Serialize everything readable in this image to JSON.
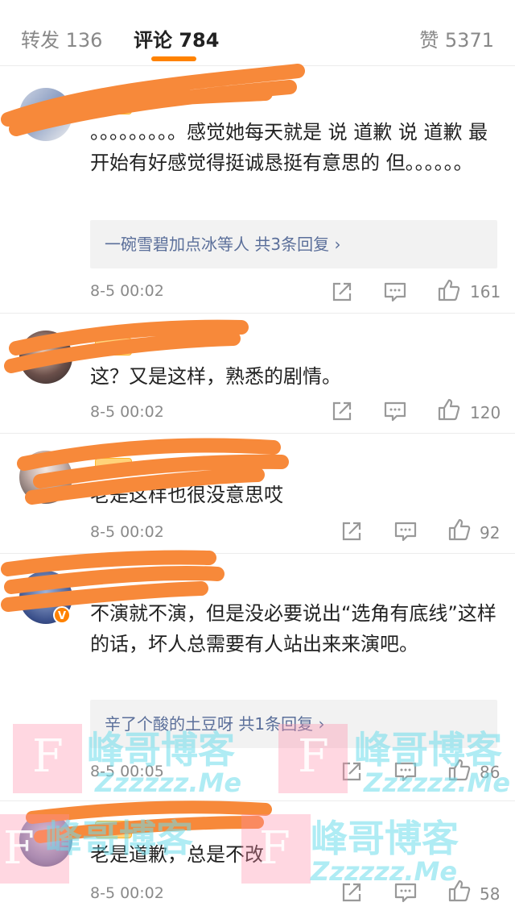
{
  "tabs": {
    "repost": "转发 136",
    "comments": "评论 784",
    "likes": "赞 5371"
  },
  "comments": [
    {
      "text": "。。。。。。。。。感觉她每天就是 说 道歉 说 道歉 最开始有好感觉得挺诚恳挺有意思的 但。。。。。。",
      "reply_summary": "一碗雪碧加点冰等人  共3条回复 ›",
      "time": "8-5 00:02",
      "likes": "161"
    },
    {
      "text": "这？又是这样，熟悉的剧情。",
      "time": "8-5 00:02",
      "likes": "120"
    },
    {
      "text": "老是这样也很没意思哎",
      "time": "8-5 00:02",
      "likes": "92"
    },
    {
      "text": "不演就不演，但是没必要说出“选角有底线”这样的话，坏人总需要有人站出来来演吧。",
      "reply_summary": "辛了个酸的土豆呀  共1条回复 ›",
      "time": "8-5 00:05",
      "likes": "86"
    },
    {
      "text": "老是道歉，总是不改",
      "time": "8-5 00:02",
      "likes": "58"
    }
  ],
  "watermark": {
    "letter": "F",
    "title": "峰哥博客",
    "url": "Zzzzzz.Me"
  },
  "icons": {
    "repost": "repost-icon",
    "comment": "comment-icon",
    "like": "thumbs-up-icon"
  },
  "colors": {
    "accent": "#ff8200",
    "link": "#5b6f9a",
    "redaction": "#f7893a"
  }
}
